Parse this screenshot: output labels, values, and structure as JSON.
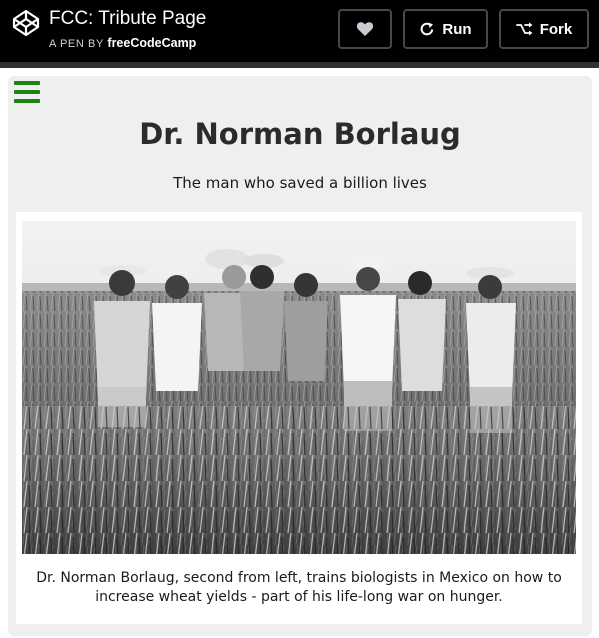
{
  "header": {
    "pen_title": "FCC: Tribute Page",
    "pen_by_prefix": "A PEN BY",
    "author": "freeCodeCamp",
    "run_label": "Run",
    "fork_label": "Fork",
    "icons": {
      "logo": "codepen-cube-icon",
      "heart": "heart-icon",
      "run": "refresh-icon",
      "fork": "fork-icon"
    },
    "colors": {
      "bar": "#000000",
      "button_border": "#454850"
    }
  },
  "tribute": {
    "menu_icon": "hamburger-menu-icon",
    "title": "Dr. Norman Borlaug",
    "subtitle": "The man who saved a billion lives",
    "image_alt": "Black and white photo of Dr. Norman Borlaug and biologists standing in a wheat field",
    "caption": "Dr. Norman Borlaug, second from left, trains biologists in Mexico on how to increase wheat yields - part of his life-long war on hunger.",
    "colors": {
      "menu": "#19840f",
      "panel": "#efefef"
    }
  }
}
